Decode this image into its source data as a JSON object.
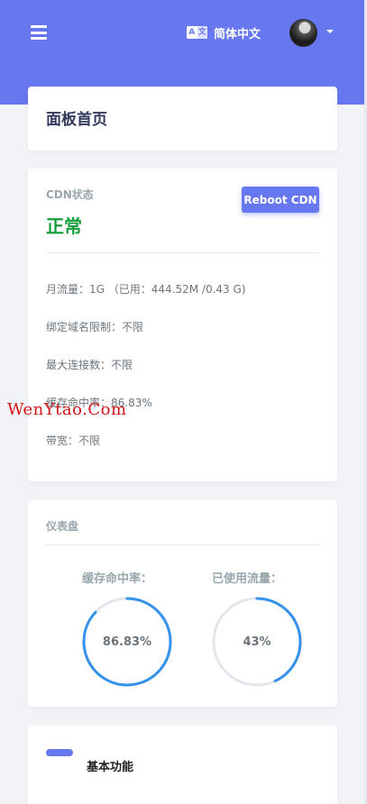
{
  "header": {
    "language_label": "简体中文",
    "language_icon_left": "A",
    "language_icon_right": "文"
  },
  "page": {
    "title": "面板首页"
  },
  "cdn": {
    "label": "CDN状态",
    "status": "正常",
    "status_color": "#169e3b",
    "reboot_label": "Reboot CDN",
    "stats": [
      {
        "key": "月流量：",
        "value": "1G （已用：444.52M /0.43 G)"
      },
      {
        "key": "绑定域名限制：",
        "value": "不限"
      },
      {
        "key": "最大连接数：",
        "value": "不限"
      },
      {
        "key": "缓存命中率：",
        "value": "86.83%"
      },
      {
        "key": "带宽：",
        "value": "不限"
      }
    ]
  },
  "watermark": "WenYtao.Com",
  "dashboard": {
    "title": "仪表盘",
    "gauges": [
      {
        "label": "缓存命中率：",
        "value_text": "86.83%",
        "percent": 86.83
      },
      {
        "label": "已使用流量：",
        "value_text": "43%",
        "percent": 43
      }
    ]
  },
  "basic": {
    "title": "基本功能"
  },
  "colors": {
    "primary": "#6777ef",
    "gauge": "#3592eb",
    "gauge_track": "#e3e6ec"
  }
}
